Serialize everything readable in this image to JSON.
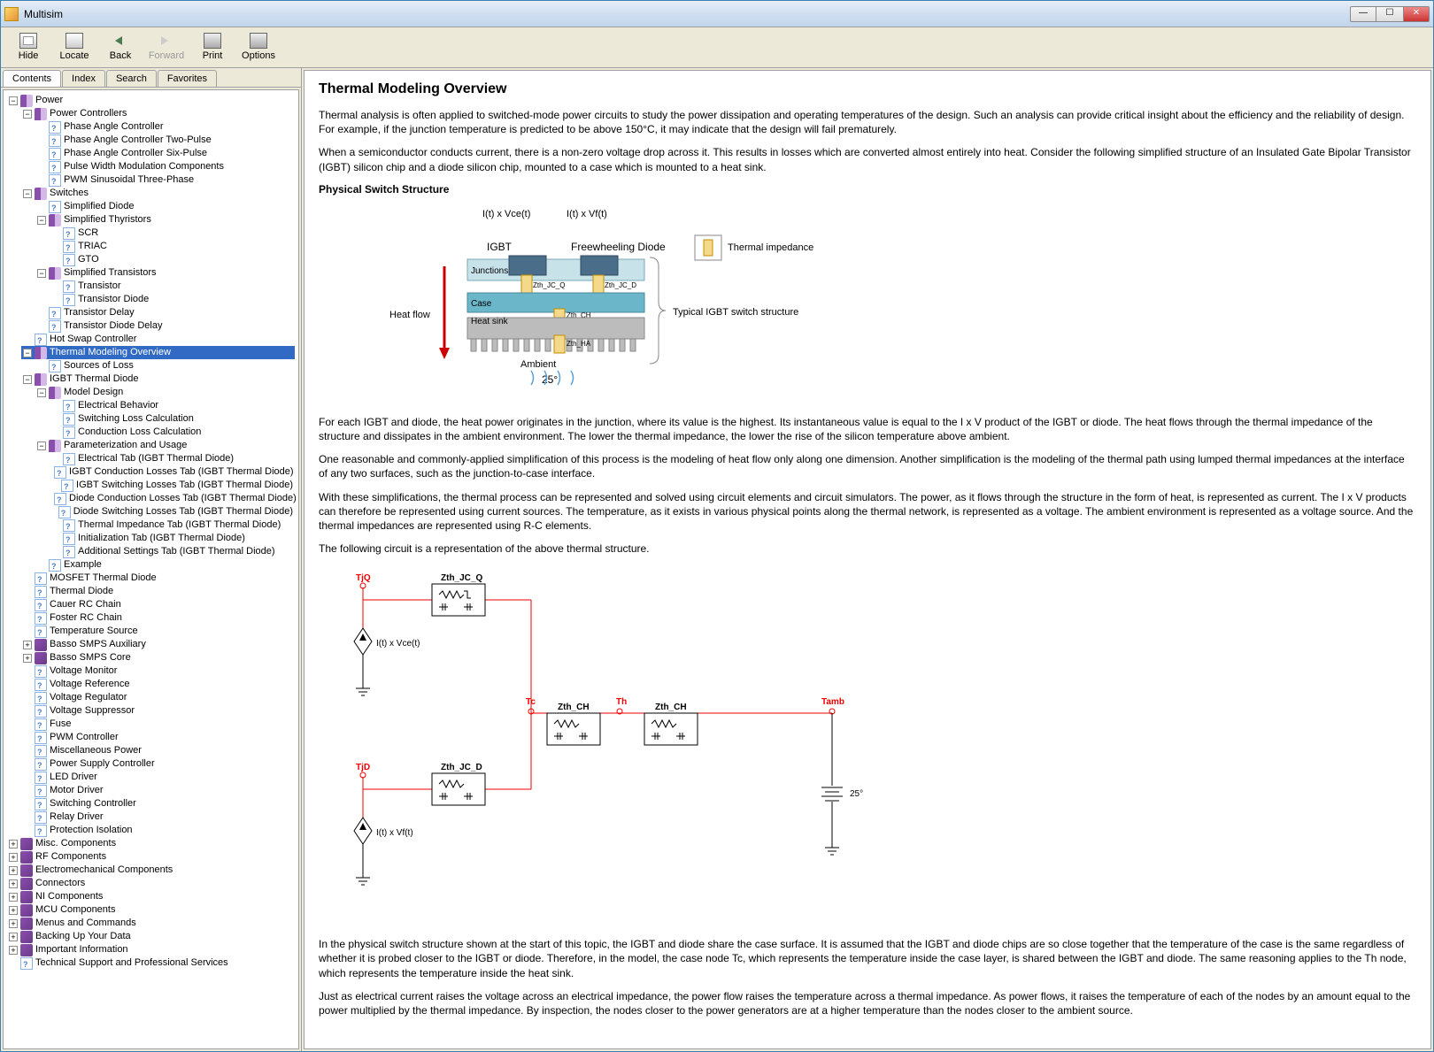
{
  "window": {
    "title": "Multisim"
  },
  "toolbar": {
    "hide": "Hide",
    "locate": "Locate",
    "back": "Back",
    "forward": "Forward",
    "print": "Print",
    "options": "Options"
  },
  "tabs": {
    "contents": "Contents",
    "index": "Index",
    "search": "Search",
    "favorites": "Favorites"
  },
  "tree": {
    "power": "Power",
    "power_controllers": "Power Controllers",
    "pac": "Phase Angle Controller",
    "pac2": "Phase Angle Controller Two-Pulse",
    "pac6": "Phase Angle Controller Six-Pulse",
    "pwmc": "Pulse Width Modulation Components",
    "pwms": "PWM Sinusoidal Three-Phase",
    "switches": "Switches",
    "sdiode": "Simplified Diode",
    "sthyr": "Simplified Thyristors",
    "scr": "SCR",
    "triac": "TRIAC",
    "gto": "GTO",
    "strans": "Simplified Transistors",
    "trans": "Transistor",
    "transd": "Transistor Diode",
    "tdelay": "Transistor Delay",
    "tddelay": "Transistor Diode Delay",
    "hotswap": "Hot Swap Controller",
    "tmo": "Thermal Modeling Overview",
    "sol": "Sources of Loss",
    "igbttd": "IGBT Thermal Diode",
    "mdesign": "Model Design",
    "ebehav": "Electrical Behavior",
    "swloss": "Switching Loss Calculation",
    "cndloss": "Conduction Loss Calculation",
    "param": "Parameterization and Usage",
    "etab": "Electrical Tab (IGBT Thermal Diode)",
    "igbtcond": "IGBT Conduction Losses Tab (IGBT Thermal Diode)",
    "igbtsw": "IGBT Switching Losses Tab (IGBT Thermal Diode)",
    "dcond": "Diode Conduction Losses Tab (IGBT Thermal Diode)",
    "dsw": "Diode Switching Losses Tab (IGBT Thermal Diode)",
    "timp": "Thermal Impedance Tab (IGBT Thermal Diode)",
    "init": "Initialization Tab (IGBT Thermal Diode)",
    "addl": "Additional Settings Tab (IGBT Thermal Diode)",
    "example": "Example",
    "mosfet": "MOSFET Thermal Diode",
    "tdiode": "Thermal Diode",
    "cauer": "Cauer RC Chain",
    "foster": "Foster RC Chain",
    "tempsrc": "Temperature Source",
    "bassoaux": "Basso SMPS Auxiliary",
    "bassocore": "Basso SMPS Core",
    "vmon": "Voltage Monitor",
    "vref": "Voltage Reference",
    "vreg": "Voltage Regulator",
    "vsup": "Voltage Suppressor",
    "fuse": "Fuse",
    "pwmctrl": "PWM Controller",
    "miscpwr": "Miscellaneous Power",
    "psctrl": "Power Supply Controller",
    "led": "LED Driver",
    "motor": "Motor Driver",
    "swctrl": "Switching Controller",
    "relay": "Relay Driver",
    "prot": "Protection Isolation",
    "misc": "Misc. Components",
    "rf": "RF Components",
    "electro": "Electromechanical Components",
    "conn": "Connectors",
    "ni": "NI Components",
    "mcu": "MCU Components",
    "menus": "Menus and Commands",
    "backup": "Backing Up Your Data",
    "important": "Important Information",
    "tech": "Technical Support and Professional Services"
  },
  "article": {
    "title": "Thermal Modeling Overview",
    "p1": "Thermal analysis is often applied to switched-mode power circuits to study the power dissipation and operating temperatures of the design. Such an analysis can provide critical insight about the efficiency and the reliability of design. For example, if the junction temperature is predicted to be above 150°C, it may indicate that the design will fail prematurely.",
    "p2": "When a semiconductor conducts current, there is a non-zero voltage drop across it. This results in losses which are converted almost entirely into heat. Consider the following simplified structure of an Insulated Gate Bipolar Transistor (IGBT) silicon chip and a diode silicon chip, mounted to a case which is mounted to a heat sink.",
    "sub1": "Physical Switch Structure",
    "d1_l1": "I(t) x Vce(t)",
    "d1_l2": "I(t) x Vf(t)",
    "d1_l3": "IGBT",
    "d1_l4": "Freewheeling Diode",
    "d1_l5": "Thermal impedance",
    "d1_l6": "Typical  IGBT switch structure",
    "d1_l7": "Heat flow",
    "d1_l8": "Junctions",
    "d1_l9": "Zth_JC_Q",
    "d1_l10": "Zth_JC_D",
    "d1_l11": "Case",
    "d1_l12": "Zth_CH",
    "d1_l13": "Heat sink",
    "d1_l14": "Zth_HA",
    "d1_l15": "Ambient",
    "d1_l16": "25°",
    "p3": "For each IGBT and diode, the heat power originates in the junction, where its value is the highest. Its instantaneous value is equal to the I x V product of the IGBT or diode. The heat flows through the thermal impedance of the structure and dissipates in the ambient environment. The lower the thermal impedance, the lower the rise of the silicon temperature above ambient.",
    "p4": "One reasonable and commonly-applied simplification of this process is the modeling of heat flow only along one dimension. Another simplification is the modeling of the thermal path using lumped thermal impedances at the interface of any two surfaces, such as the junction-to-case interface.",
    "p5": "With these simplifications, the thermal process can be represented and solved using circuit elements and circuit simulators. The power, as it flows through the structure in the form of heat, is represented as current. The I x V products can therefore be represented using current sources. The temperature, as it exists in various physical points along the thermal network, is represented as a voltage. The ambient environment is represented as a voltage source. And the thermal impedances are represented using R-C elements.",
    "p6": "The following circuit is a representation of the above thermal structure.",
    "c_tjq": "TjQ",
    "c_zjcq": "Zth_JC_Q",
    "c_ivce": "I(t) x Vce(t)",
    "c_tc": "Tc",
    "c_zch": "Zth_CH",
    "c_th": "Th",
    "c_zch2": "Zth_CH",
    "c_tamb": "Tamb",
    "c_25": "25°",
    "c_tjd": "TjD",
    "c_zjcd": "Zth_JC_D",
    "c_ivf": "I(t) x Vf(t)",
    "p7": "In the physical switch structure shown at the start of this topic, the IGBT and diode share the case surface. It is assumed that the IGBT and diode chips are so close together that the temperature of the case is the same regardless of whether it is probed closer to the IGBT or diode. Therefore, in the model, the case node Tc, which represents the temperature inside the case layer, is shared between the IGBT and diode. The same reasoning applies to the Th node, which represents the temperature inside the heat sink.",
    "p8": "Just as electrical current raises the voltage across an electrical impedance, the power flow raises the temperature across a thermal impedance. As power flows, it raises the temperature of each of the nodes by an amount equal to the power multiplied by the thermal impedance. By inspection, the nodes closer to the power generators are at a higher temperature than the nodes closer to the ambient source."
  }
}
